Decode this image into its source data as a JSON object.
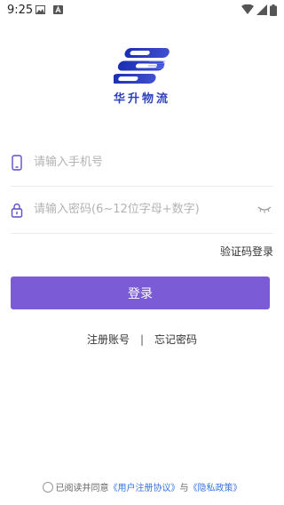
{
  "status": {
    "time": "9:25",
    "left_icons": [
      "image-icon",
      "font-a-icon"
    ],
    "right_icons": [
      "wifi-icon",
      "signal-icon",
      "battery-icon"
    ]
  },
  "brand": {
    "name": "华升物流",
    "color": "#2b3fbf"
  },
  "form": {
    "phone_placeholder": "请输入手机号",
    "password_placeholder": "请输入密码(6~12位字母+数字)",
    "sms_login_label": "验证码登录",
    "login_label": "登录"
  },
  "links": {
    "register_label": "注册账号",
    "separator": "|",
    "forgot_label": "忘记密码"
  },
  "agreement": {
    "prefix": "已阅读并同意",
    "user_agreement": "《用户注册协议》",
    "conjunction": "与",
    "privacy_policy": "《隐私政策》"
  },
  "colors": {
    "accent": "#7b5bd6",
    "link": "#3a76e0"
  }
}
